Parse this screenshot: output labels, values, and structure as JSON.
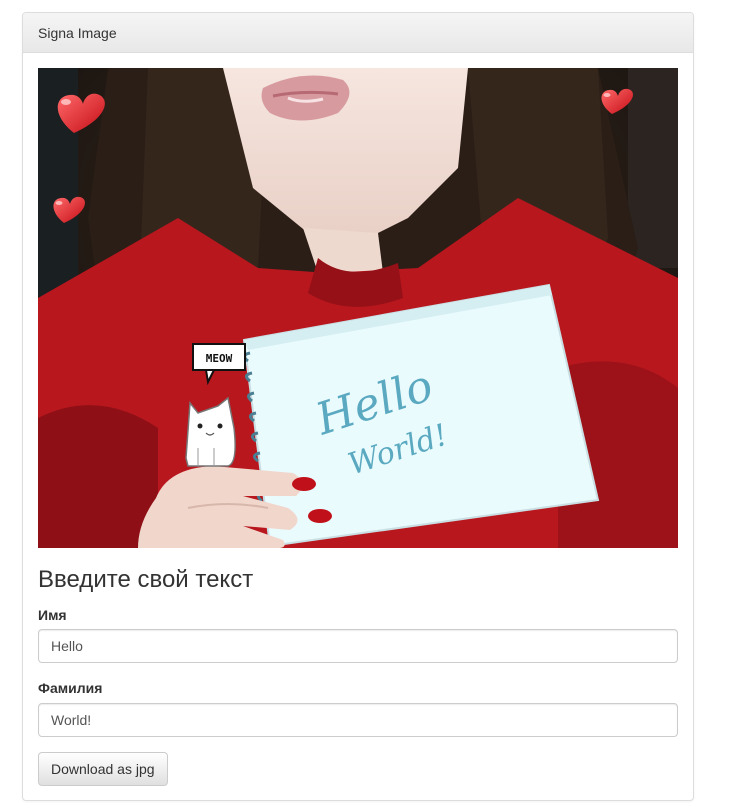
{
  "panel": {
    "title": "Signa Image"
  },
  "image": {
    "description_icons": [
      "heart-icon",
      "cat-sticker-icon",
      "speech-bubble-icon"
    ],
    "sign_text_line1": "Hello",
    "sign_text_line2": "World!",
    "sticker_text": "MEOW",
    "colors": {
      "sweater": "#b8171e",
      "sign": "#e9fbfd",
      "sign_text": "#5aa9c0",
      "heart": "#e8262b"
    }
  },
  "form": {
    "heading": "Введите свой текст",
    "first_name_label": "Имя",
    "first_name_value": "Hello",
    "last_name_label": "Фамилия",
    "last_name_value": "World!",
    "download_label": "Download as jpg"
  }
}
